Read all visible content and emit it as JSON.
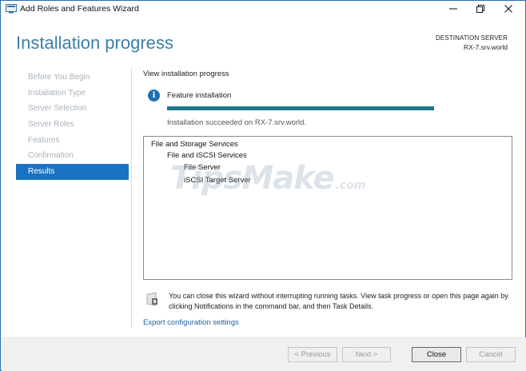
{
  "window": {
    "title": "Add Roles and Features Wizard",
    "controls": {
      "minimize": "—",
      "restore": "❐",
      "close": "✕"
    }
  },
  "header": {
    "page_title": "Installation progress",
    "destination_label": "DESTINATION SERVER",
    "destination_server": "RX-7.srv.world"
  },
  "nav": {
    "items": [
      {
        "label": "Before You Begin",
        "active": false
      },
      {
        "label": "Installation Type",
        "active": false
      },
      {
        "label": "Server Selection",
        "active": false
      },
      {
        "label": "Server Roles",
        "active": false
      },
      {
        "label": "Features",
        "active": false
      },
      {
        "label": "Confirmation",
        "active": false
      },
      {
        "label": "Results",
        "active": true
      }
    ]
  },
  "main": {
    "view_progress_label": "View installation progress",
    "info_icon": "info-icon",
    "feature_installation_label": "Feature installation",
    "progress_percent": 100,
    "status_text": "Installation succeeded on RX-7.srv.world.",
    "results_tree": [
      {
        "text": "File and Storage Services",
        "level": 0
      },
      {
        "text": "File and iSCSI Services",
        "level": 1
      },
      {
        "text": "File Server",
        "level": 2
      },
      {
        "text": "iSCSI Target Server",
        "level": 2
      }
    ],
    "watermark": {
      "main": "TipsMake",
      "suffix": ".com"
    },
    "notice_text": "You can close this wizard without interrupting running tasks. View task progress or open this page again by clicking Notifications in the command bar, and then Task Details.",
    "export_link": "Export configuration settings"
  },
  "footer": {
    "previous": "< Previous",
    "next": "Next >",
    "close": "Close",
    "cancel": "Cancel"
  },
  "colors": {
    "accent": "#1a73c2",
    "title_blue": "#3d7fa6",
    "progress": "#22768c",
    "link": "#1f5f9e"
  }
}
